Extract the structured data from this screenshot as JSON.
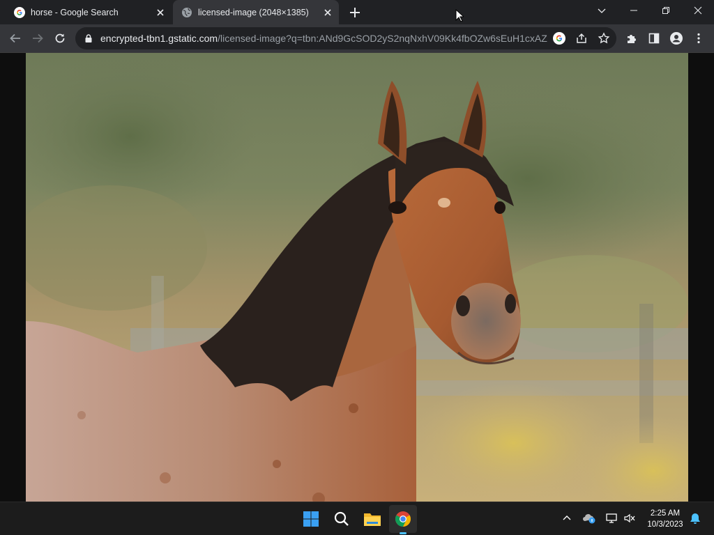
{
  "browser": {
    "tabs": [
      {
        "title": "horse - Google Search",
        "state": "inactive",
        "favicon": "google-g-icon"
      },
      {
        "title": "licensed-image (2048×1385)",
        "state": "active",
        "favicon": "globe-icon"
      }
    ],
    "address": {
      "host": "encrypted-tbn1.gstatic.com",
      "path": "/licensed-image?q=tbn:ANd9GcSOD2yS2nqNxhV09Kk4fbOZw6sEuH1cxAZ..."
    }
  },
  "content": {
    "image_subject": "bay roan horse with dark mane"
  },
  "taskbar": {
    "apps": [
      "windows-start-icon",
      "search-icon",
      "file-explorer-icon",
      "chrome-icon"
    ],
    "active_app": "chrome-icon",
    "clock": {
      "time": "2:25 AM",
      "date": "10/3/2023"
    }
  },
  "colors": {
    "tab_bar": "#202124",
    "toolbar": "#35363a",
    "taskbar": "#1c1c1c",
    "accent": "#4cc2ff"
  }
}
